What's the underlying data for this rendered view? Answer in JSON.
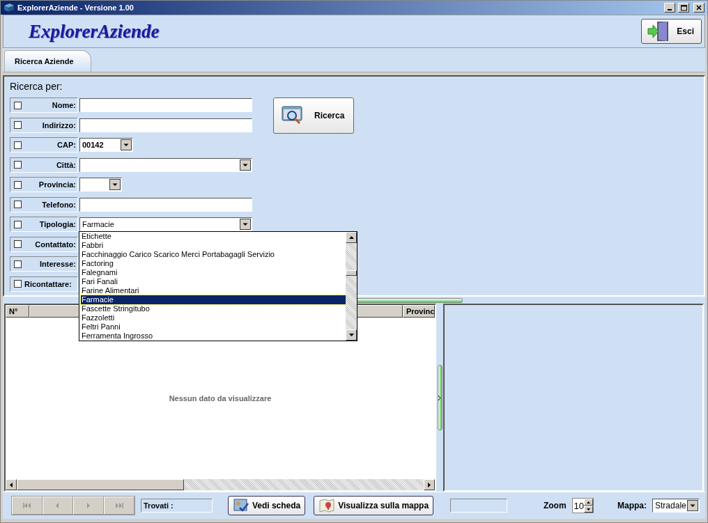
{
  "window": {
    "title": "ExplorerAziende  -  Versione 1.00"
  },
  "header": {
    "logo": "ExplorerAziende",
    "exit_button": "Esci"
  },
  "tabs": [
    {
      "label": "Ricerca Aziende",
      "selected": true
    }
  ],
  "search": {
    "title": "Ricerca per:",
    "button": "Ricerca",
    "fields": [
      {
        "label": "Nome:",
        "checked": false,
        "kind": "text"
      },
      {
        "label": "Indirizzo:",
        "checked": false,
        "kind": "text"
      },
      {
        "label": "CAP:",
        "checked": false,
        "kind": "short-combo",
        "value": "00142"
      },
      {
        "label": "Città:",
        "checked": false,
        "kind": "combo"
      },
      {
        "label": "Provincia:",
        "checked": false,
        "kind": "tiny-combo"
      },
      {
        "label": "Telefono:",
        "checked": false,
        "kind": "text"
      },
      {
        "label": "Tipologia:",
        "checked": false,
        "kind": "combo",
        "value": "Farmacie",
        "expanded": true
      },
      {
        "label": "Contattato:",
        "checked": false,
        "kind": "covered"
      },
      {
        "label": "Interesse:",
        "checked": false,
        "kind": "covered"
      },
      {
        "label": "Ricontattare:",
        "checked": false,
        "kind": "covered"
      }
    ]
  },
  "dropdown": {
    "items": [
      {
        "label": "Etichette",
        "selected": false
      },
      {
        "label": "Fabbri",
        "selected": false
      },
      {
        "label": "Facchinaggio Carico Scarico Merci Portabagagli Servizio",
        "selected": false
      },
      {
        "label": "Factoring",
        "selected": false
      },
      {
        "label": "Falegnami",
        "selected": false
      },
      {
        "label": "Fari Fanali",
        "selected": false
      },
      {
        "label": "Farine Alimentari",
        "selected": false
      },
      {
        "label": "Farmacie",
        "selected": true
      },
      {
        "label": "Fascette Stringitubo",
        "selected": false
      },
      {
        "label": "Fazzoletti",
        "selected": false
      },
      {
        "label": "Feltri Panni",
        "selected": false
      },
      {
        "label": "Ferramenta Ingrosso",
        "selected": false
      }
    ]
  },
  "results": {
    "columns": [
      "N°",
      "Provinc"
    ],
    "empty_text": "Nessun dato da visualizzare"
  },
  "navigation": [
    {
      "kind": "first",
      "disabled": true
    },
    {
      "kind": "prev",
      "disabled": true
    },
    {
      "kind": "next",
      "disabled": true
    },
    {
      "kind": "last",
      "disabled": true
    }
  ],
  "footer": {
    "found_label": "Trovati :",
    "buttons": [
      {
        "label": "Vedi scheda",
        "kind": "card"
      },
      {
        "label": "Visualizza sulla mappa",
        "kind": "map"
      }
    ]
  },
  "map": {
    "zoom_label": "Zoom",
    "zoom": "10",
    "map_label": "Mappa:",
    "map_type": "Stradale"
  }
}
